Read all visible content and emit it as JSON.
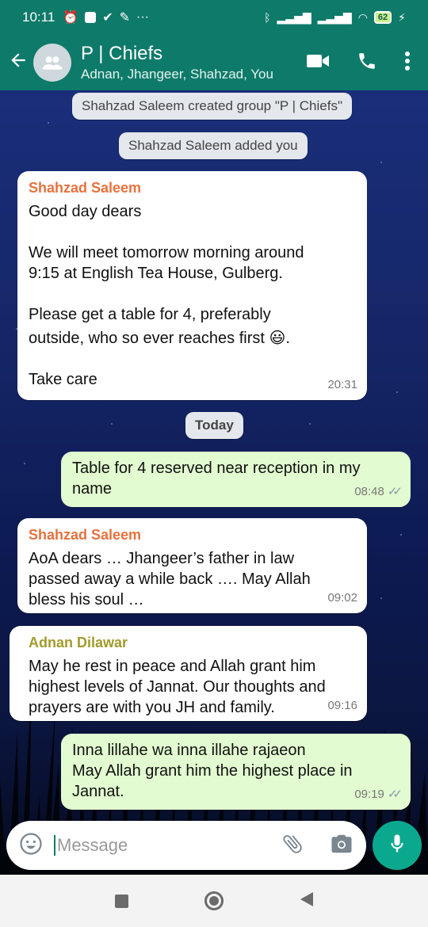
{
  "status_bar": {
    "time": "10:11",
    "battery": "62",
    "more": "···"
  },
  "header": {
    "title": "P | Chiefs",
    "subtitle": "Adnan, Jhangeer, Shahzad, You"
  },
  "system_messages": [
    "Shahzad Saleem created group \"P | Chiefs\"",
    "Shahzad Saleem added you"
  ],
  "date_divider": "Today",
  "messages": [
    {
      "direction": "in",
      "sender": "Shahzad Saleem",
      "lines": [
        "Good day dears",
        "",
        "We will meet tomorrow morning around",
        "9:15 at English Tea House, Gulberg.",
        "",
        "Please get a table for 4, preferably",
        "outside, who so ever reaches first 😃.",
        "",
        "Take care"
      ],
      "time": "20:31"
    },
    {
      "direction": "out",
      "lines": [
        "Table for 4 reserved near reception in my",
        "name"
      ],
      "time": "08:48"
    },
    {
      "direction": "in",
      "sender": "Shahzad Saleem",
      "lines": [
        "AoA dears … Jhangeer’s father in law",
        "passed away a while back …. May Allah",
        "bless his soul …"
      ],
      "time": "09:02"
    },
    {
      "direction": "in",
      "sender": "Adnan Dilawar",
      "lines": [
        "May he rest in peace and Allah grant him",
        "highest levels of Jannat. Our thoughts and",
        "prayers are with you JH and family."
      ],
      "time": "09:16"
    },
    {
      "direction": "out",
      "lines": [
        "Inna lillahe wa inna illahe rajaeon",
        "May Allah grant him the highest place in",
        "Jannat."
      ],
      "time": "09:19"
    }
  ],
  "composer": {
    "placeholder": "Message"
  },
  "colors": {
    "header_green": "#0e7a6a",
    "outgoing_bubble": "#e2fbd0",
    "incoming_bubble": "#ffffff",
    "sender_orange": "#e6723d",
    "sender_olive": "#a19b2c",
    "mic_button": "#0aa98e"
  },
  "icons": [
    "back-arrow-icon",
    "group-avatar-icon",
    "video-call-icon",
    "voice-call-icon",
    "more-vert-icon",
    "emoji-icon",
    "attach-icon",
    "camera-icon",
    "mic-icon"
  ]
}
